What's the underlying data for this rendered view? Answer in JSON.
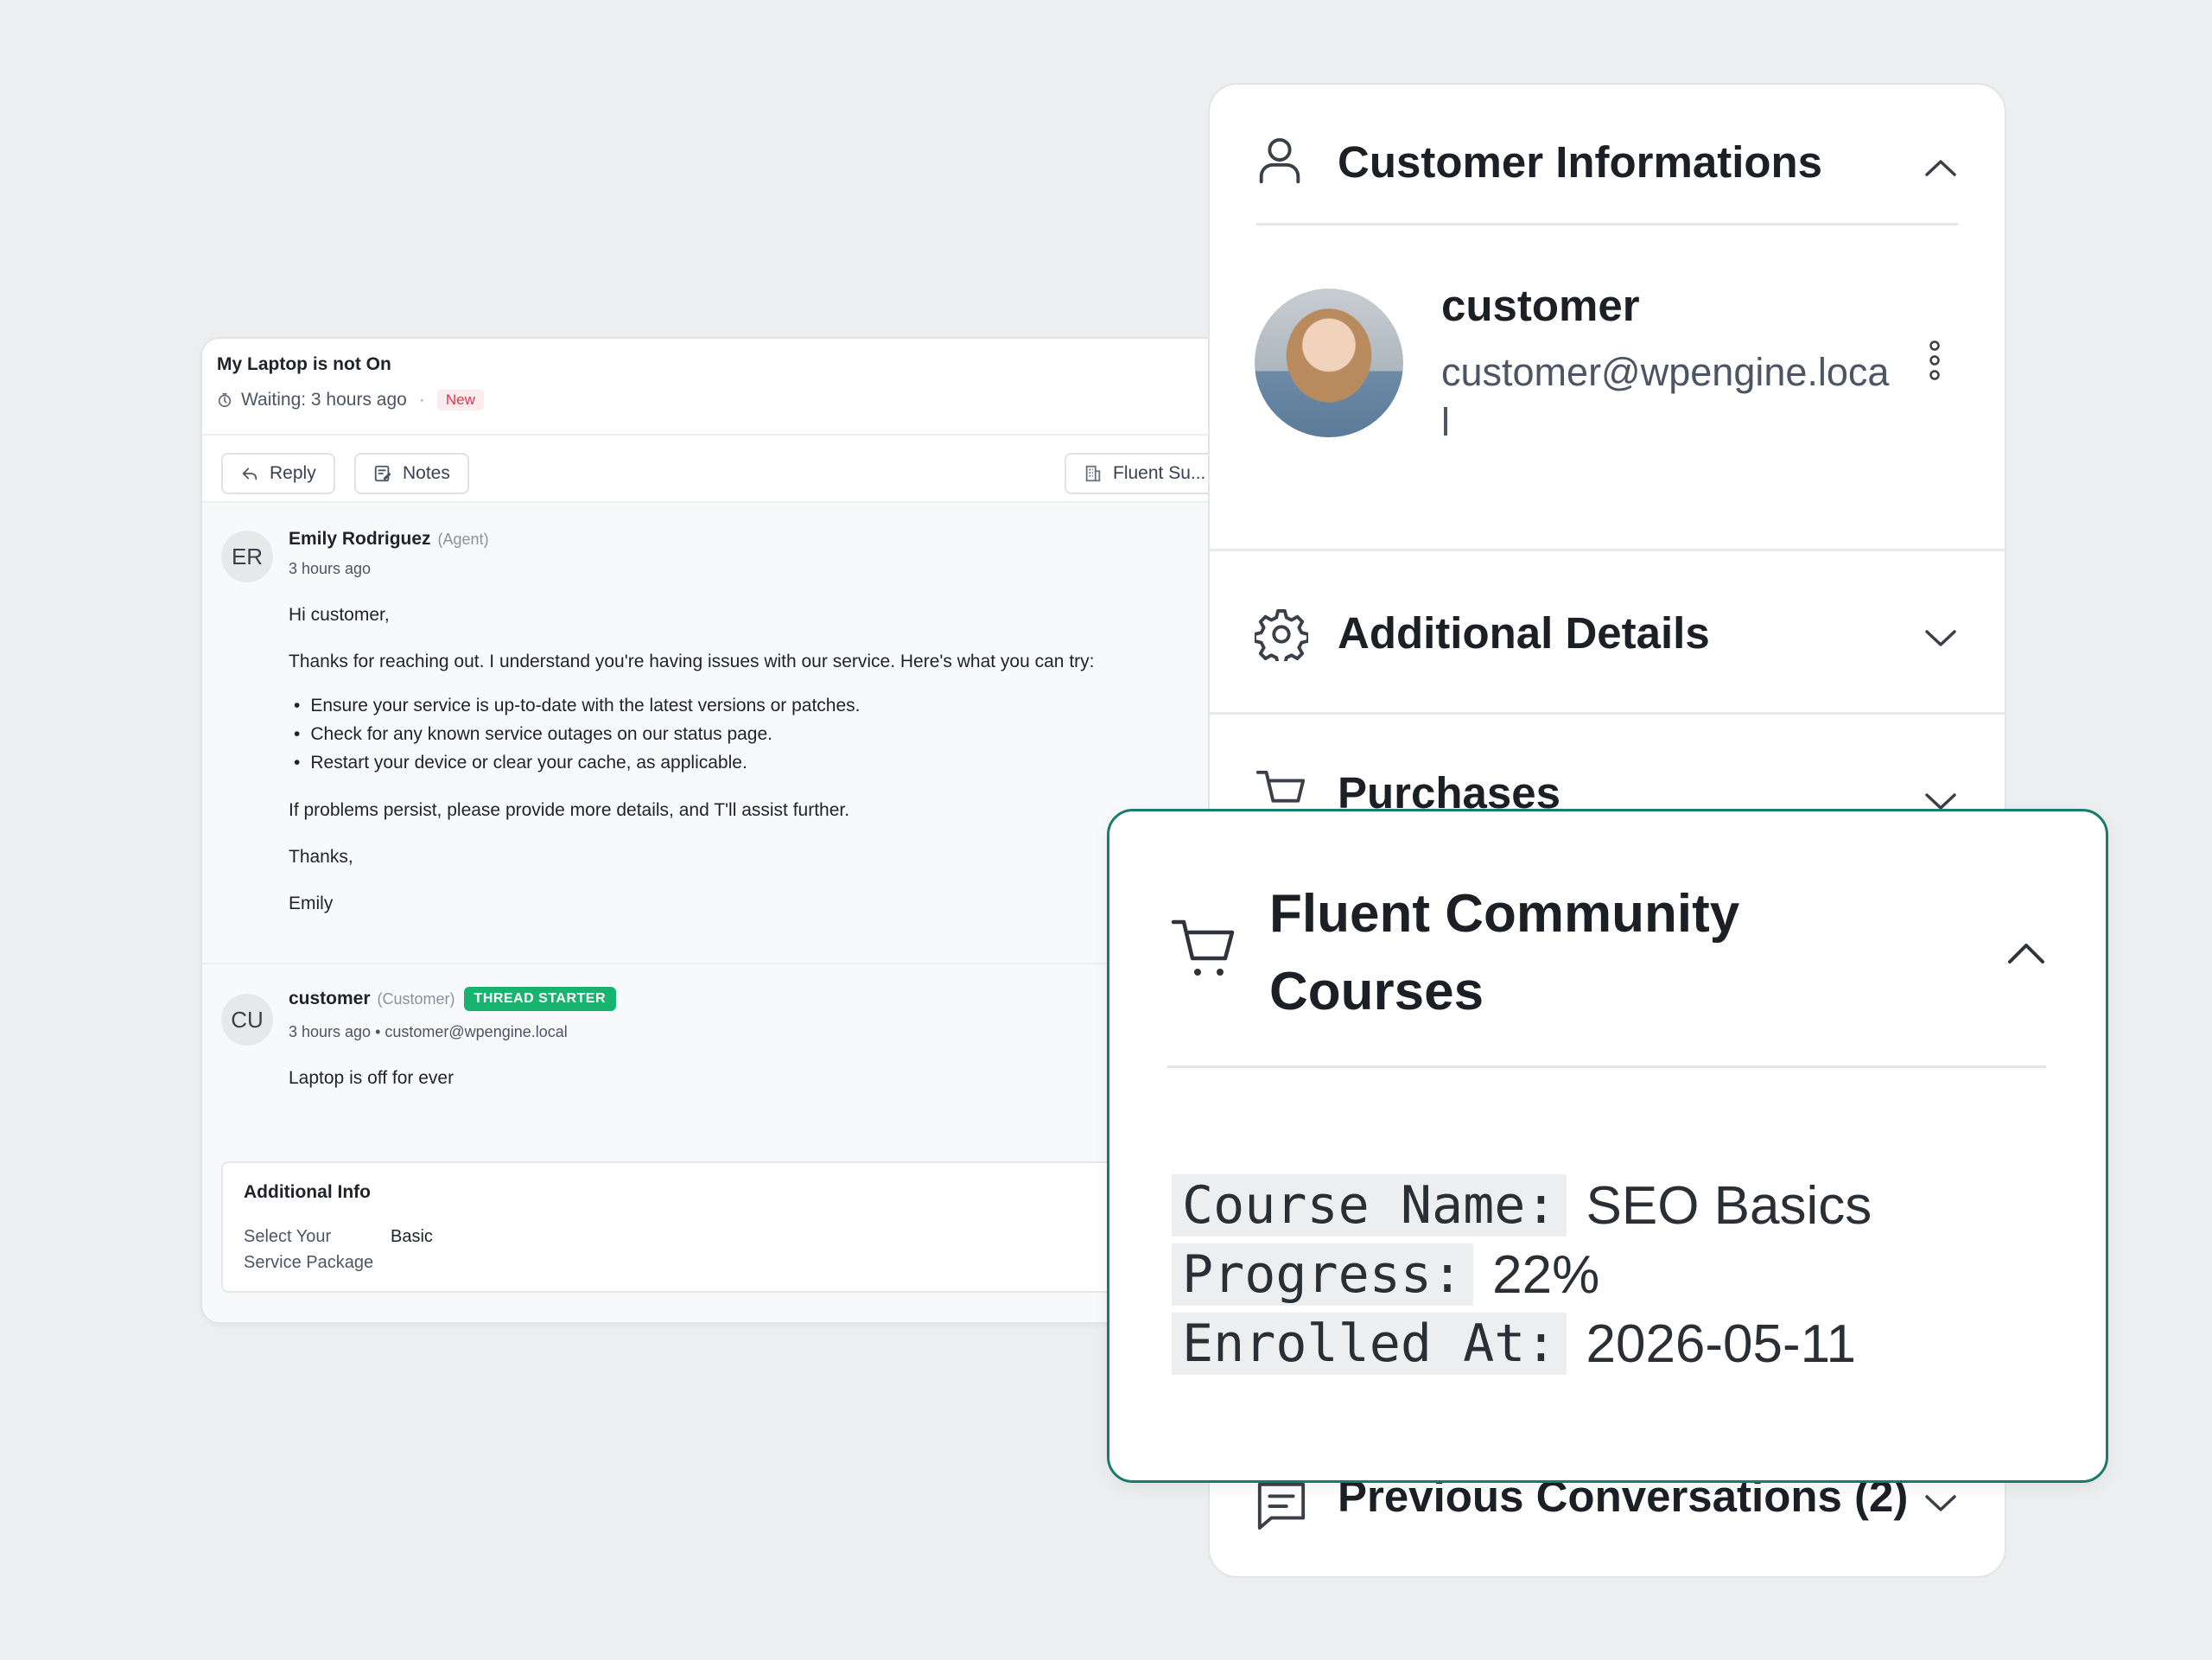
{
  "ticket": {
    "title": "My Laptop is not On",
    "waiting": "Waiting: 3 hours ago",
    "status": "New",
    "reply_label": "Reply",
    "notes_label": "Notes",
    "mailbox_label": "Fluent Su..."
  },
  "messages": [
    {
      "initials": "ER",
      "name": "Emily Rodriguez",
      "role": "(Agent)",
      "time": "3 hours ago",
      "greeting": "Hi customer,",
      "intro": "Thanks for reaching out. I understand you're having issues with our service. Here's what you can try:",
      "bullets": [
        "Ensure your service is up-to-date with the latest versions or patches.",
        "Check for any known service outages on our status page.",
        "Restart your device or clear your cache, as applicable."
      ],
      "followup": "If problems persist, please provide more details, and T'll assist further.",
      "signoff": "Thanks,",
      "signature": "Emily"
    },
    {
      "initials": "CU",
      "name": "customer",
      "role": "(Customer)",
      "badge": "THREAD STARTER",
      "time_email": "3 hours ago • customer@wpengine.local",
      "body": "Laptop is off for ever"
    }
  ],
  "additional_info": {
    "title": "Additional Info",
    "field_label": "Select Your Service Package",
    "field_value": "Basic"
  },
  "sidebar": {
    "customer_info_title": "Customer Informations",
    "customer_name": "customer",
    "customer_email": "customer@wpengine.local",
    "additional_details_title": "Additional Details",
    "purchases_title": "Purchases",
    "previous_conversations_title": "Previous Conversations (2)"
  },
  "focus_card": {
    "title": "Fluent Community Courses",
    "rows": [
      {
        "key": "Course Name:",
        "value": "SEO Basics"
      },
      {
        "key": "Progress:",
        "value": "22%"
      },
      {
        "key": "Enrolled At:",
        "value": "2026-05-11"
      }
    ]
  },
  "icons": {
    "clock": "clock-icon",
    "reply": "reply-icon",
    "notes": "notes-icon",
    "mailbox": "building-icon",
    "user": "user-icon",
    "gear": "gear-icon",
    "cart": "cart-icon",
    "chat": "chat-icon",
    "chevron_up": "chevron-up-icon",
    "chevron_down": "chevron-down-icon",
    "kebab": "more-vertical-icon"
  },
  "colors": {
    "accent_green": "#18b36f",
    "focus_border": "#1b7a6e",
    "new_badge": "#e0374a"
  }
}
